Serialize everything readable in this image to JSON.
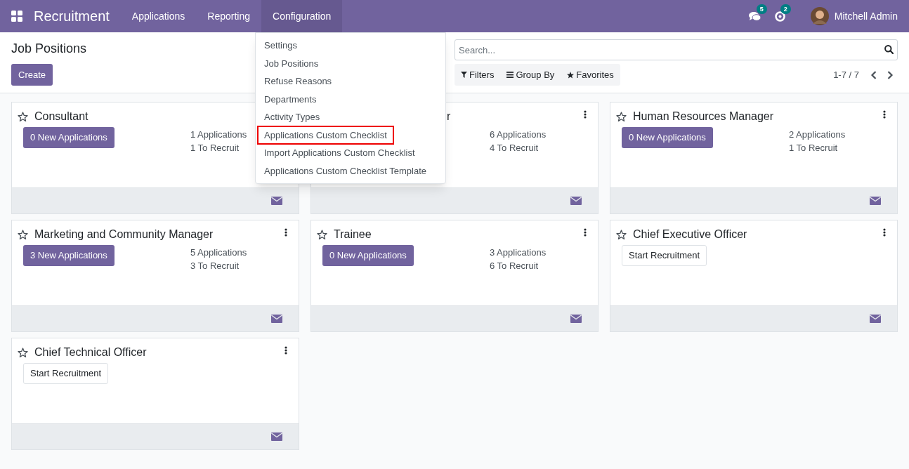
{
  "navbar": {
    "app_name": "Recruitment",
    "menus": [
      {
        "label": "Applications",
        "selected": false
      },
      {
        "label": "Reporting",
        "selected": false
      },
      {
        "label": "Configuration",
        "selected": true
      }
    ],
    "messages_count": "5",
    "activities_count": "2",
    "user": "Mitchell Admin"
  },
  "control_panel": {
    "title": "Job Positions",
    "create_button": "Create",
    "search": {
      "placeholder": "Search..."
    },
    "filters": [
      "Filters",
      "Group By",
      "Favorites"
    ],
    "pager": "1-7 / 7"
  },
  "dropdown": {
    "items": [
      {
        "label": "Settings",
        "highlighted": false
      },
      {
        "label": "Job Positions",
        "highlighted": false
      },
      {
        "label": "Refuse Reasons",
        "highlighted": false
      },
      {
        "label": "Departments",
        "highlighted": false
      },
      {
        "label": "Activity Types",
        "highlighted": false
      },
      {
        "label": "Applications Custom Checklist",
        "highlighted": true
      },
      {
        "label": "Import Applications Custom Checklist",
        "highlighted": false
      },
      {
        "label": "Applications Custom Checklist Template",
        "highlighted": false
      }
    ]
  },
  "cards": [
    {
      "kind": "open",
      "title": "Consultant",
      "button": "0 New Applications",
      "applications": "1 Applications",
      "to_recruit": "1 To Recruit"
    },
    {
      "kind": "covered",
      "title": "r",
      "applications": "6 Applications",
      "to_recruit": "4 To Recruit"
    },
    {
      "kind": "open",
      "title": "Human Resources Manager",
      "button": "0 New Applications",
      "applications": "2 Applications",
      "to_recruit": "1 To Recruit"
    },
    {
      "kind": "open",
      "title": "Marketing and Community Manager",
      "button": "3 New Applications",
      "applications": "5 Applications",
      "to_recruit": "3 To Recruit"
    },
    {
      "kind": "open",
      "title": "Trainee",
      "button": "0 New Applications",
      "applications": "3 Applications",
      "to_recruit": "6 To Recruit"
    },
    {
      "kind": "start",
      "title": "Chief Executive Officer",
      "button": "Start Recruitment"
    },
    {
      "kind": "start",
      "title": "Chief Technical Officer",
      "button": "Start Recruitment"
    }
  ]
}
